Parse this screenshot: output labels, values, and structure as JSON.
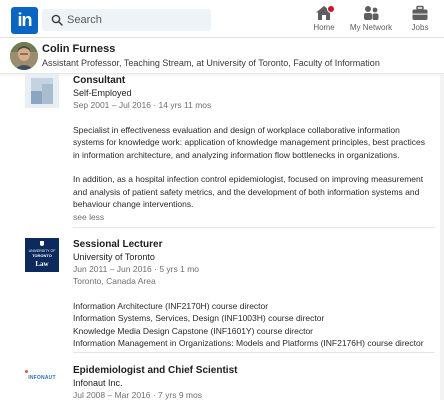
{
  "nav": {
    "logo_text": "in",
    "search_placeholder": "Search",
    "items": [
      {
        "label": "Home",
        "icon": "home-icon"
      },
      {
        "label": "My Network",
        "icon": "people-icon"
      },
      {
        "label": "Jobs",
        "icon": "briefcase-icon"
      }
    ],
    "colors": {
      "brand": "#0a66c2",
      "notification": "#d11124"
    }
  },
  "profile": {
    "name": "Colin Furness",
    "headline": "Assistant Professor, Teaching Stream, at University of Toronto, Faculty of Information"
  },
  "experience": [
    {
      "title": "Consultant",
      "company": "Self-Employed",
      "dates": "Sep 2001 – Jul 2016 · 14 yrs 11 mos",
      "paragraphs": [
        "Specialist in effectiveness evaluation and design of workplace collaborative information systems for knowledge work: application of knowledge management principles, best practices in information architecture, and analyzing information flow bottlenecks in organizations.",
        "In addition, as a hospital infection control epidemiologist, focused on improving measurement and analysis of patient safety metrics, and the development of both information systems and behaviour change interventions."
      ],
      "see_less": "see less"
    },
    {
      "title": "Sessional Lecturer",
      "company": "University of Toronto",
      "dates": "Jun 2011 – Jun 2016 · 5 yrs 1 mo",
      "location": "Toronto, Canada Area",
      "logo_text": [
        "UNIVERSITY OF",
        "TORONTO",
        "Law"
      ],
      "lines": [
        "Information Architecture (INF2170H) course director",
        "Information Systems, Services, Design (INF1003H) course director",
        "Knowledge Media Design Capstone (INF1601Y) course director",
        "Information Management in Organizations: Models and Platforms (INF2176H) course director"
      ]
    },
    {
      "title": "Epidemiologist and Chief Scientist",
      "company": "Infonaut Inc.",
      "dates": "Jul 2008 – Mar 2016 · 7 yrs 9 mos",
      "logo_text": "INFONAUT"
    }
  ]
}
